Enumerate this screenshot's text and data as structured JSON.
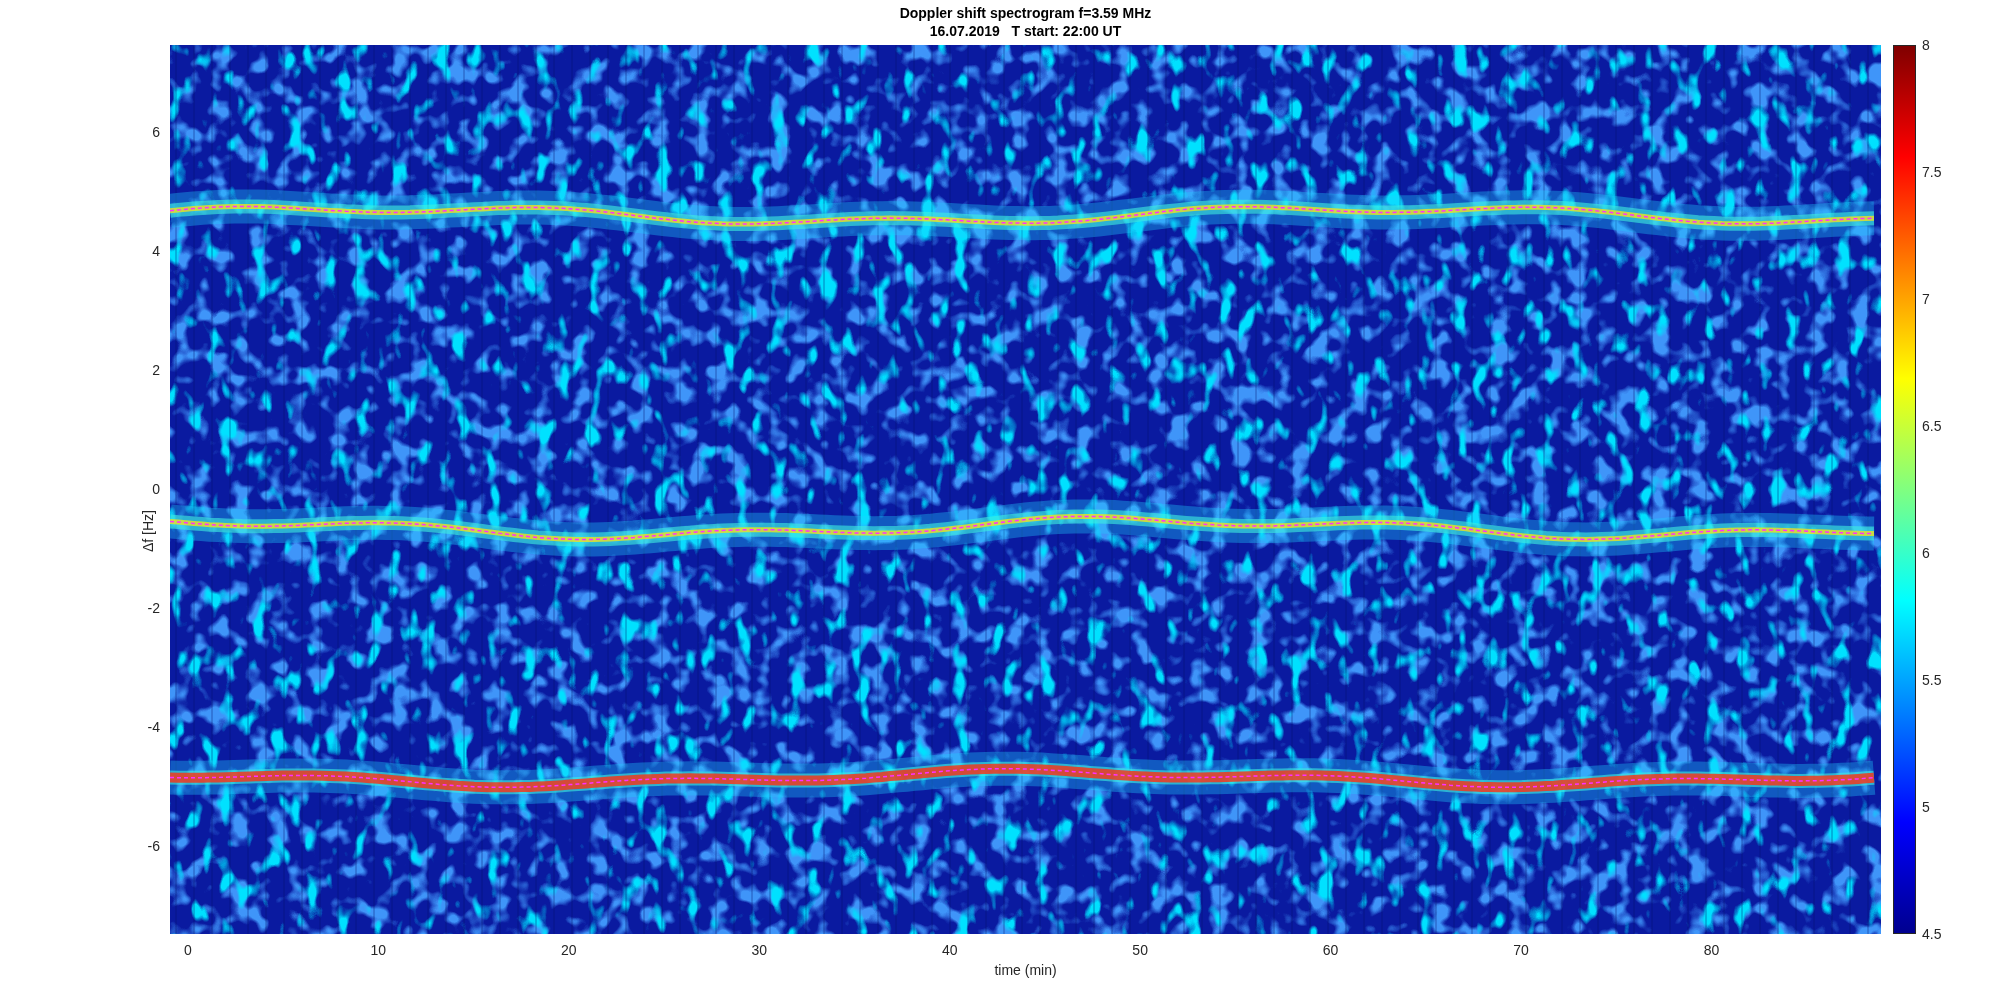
{
  "title": [
    "Doppler shift spectrogram f=3.59 MHz",
    "16.07.2019   T start: 22:00 UT"
  ],
  "ylabel": "Δf [Hz]",
  "xlabel": "time (min)",
  "yticks": [
    "6",
    "4",
    "2",
    "0",
    "-2",
    "-4",
    "-6"
  ],
  "xticks": [
    "0",
    "10",
    "20",
    "30",
    "40",
    "50",
    "60",
    "70",
    "80"
  ],
  "colorbar_ticks": [
    "8",
    "7.5",
    "7",
    "6.5",
    "6",
    "5.5",
    "5",
    "4.5"
  ]
}
